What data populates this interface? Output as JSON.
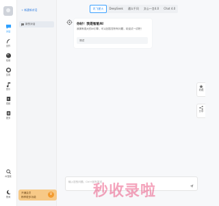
{
  "rail": {
    "items": [
      {
        "label": "对话",
        "icon": "chat-icon"
      },
      {
        "label": "创作",
        "icon": "feather-icon"
      },
      {
        "label": "绘画",
        "icon": "palette-icon"
      },
      {
        "label": "应用",
        "icon": "grid-icon"
      },
      {
        "label": "音乐",
        "icon": "music-icon"
      },
      {
        "label": "视频",
        "icon": "video-icon"
      },
      {
        "label": "更多",
        "icon": "more-icon"
      }
    ],
    "bottom_items": [
      {
        "label": "AI搜索",
        "icon": "search-icon"
      },
      {
        "label": "夜间",
        "icon": "moon-icon"
      }
    ]
  },
  "history": {
    "new_chat_label": "+ 新建新对话",
    "items": [
      {
        "label": "新的对话"
      }
    ]
  },
  "vip": {
    "line1": "开通会员",
    "line2": "畅享更多功能",
    "badge": "V"
  },
  "tabs": [
    {
      "label": "讯飞星火",
      "active": true
    },
    {
      "label": "DeepSeek",
      "active": false
    },
    {
      "label": "通义千问",
      "active": false
    },
    {
      "label": "文心一言4.0",
      "active": false
    },
    {
      "label": "Chat 4.0",
      "active": false
    }
  ],
  "welcome": {
    "title": "你好！我是智能AI",
    "subtitle": "我拥有强大的AI引擎，可以回答您所有问题，欢迎试一试吧！",
    "suggestion": "测试"
  },
  "side_buttons": [
    {
      "label": "收藏",
      "icon": "star-icon"
    },
    {
      "label": "分享",
      "icon": "share-icon"
    }
  ],
  "input": {
    "placeholder": "输入您的问题，Ctrl+回车发送"
  },
  "watermark": "秒收录啦",
  "colors": {
    "accent": "#2ea0ff",
    "vip_bg": "#f7c987",
    "watermark": "#e94a7a"
  }
}
